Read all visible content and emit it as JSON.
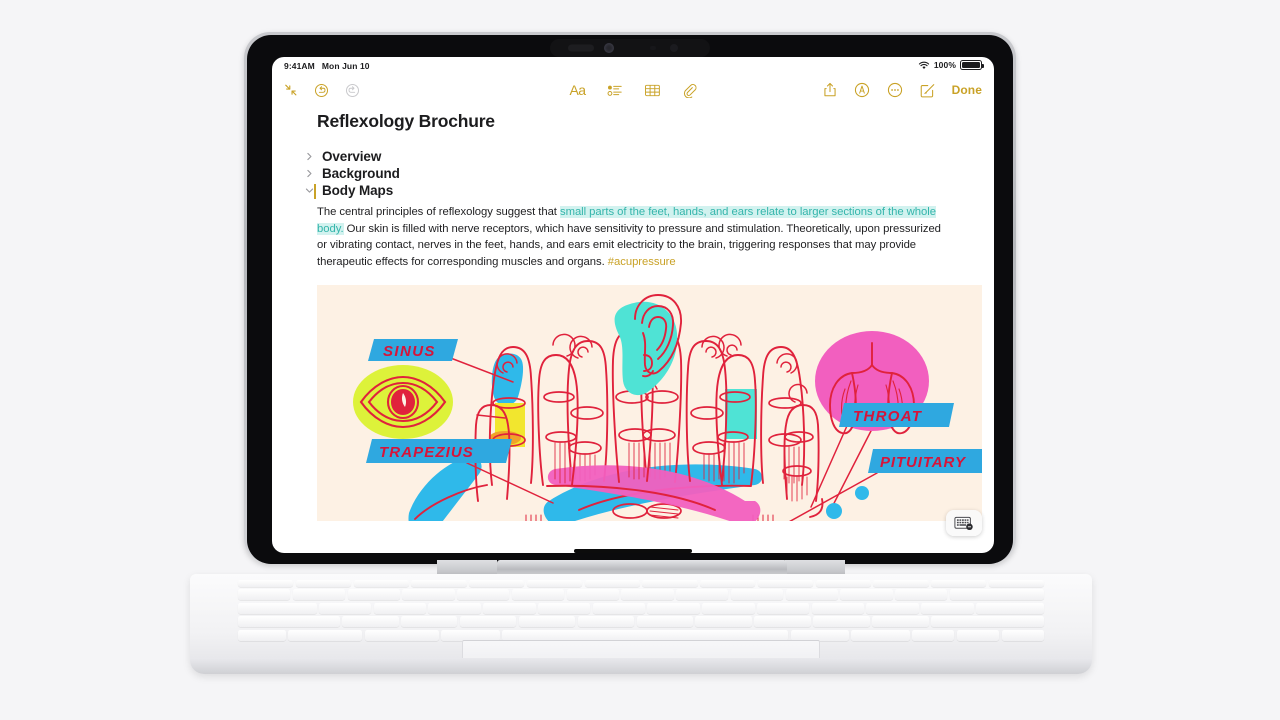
{
  "device": {
    "type": "tablet-with-keyboard",
    "label": "iPad with Magic Keyboard"
  },
  "status_bar": {
    "time": "9:41AM",
    "date": "Mon Jun 10",
    "wifi_icon": "wifi-icon",
    "battery_percent": "100%",
    "battery_icon": "battery-full-icon"
  },
  "toolbar": {
    "left": [
      {
        "name": "collapse-icon",
        "label": "Collapse"
      },
      {
        "name": "undo-icon",
        "label": "Undo"
      },
      {
        "name": "redo-icon",
        "label": "Redo"
      }
    ],
    "center": [
      {
        "name": "format-text-icon",
        "label": "Aa"
      },
      {
        "name": "checklist-icon",
        "label": "Checklist"
      },
      {
        "name": "table-icon",
        "label": "Table"
      },
      {
        "name": "attachment-icon",
        "label": "Attach"
      }
    ],
    "right": [
      {
        "name": "share-icon",
        "label": "Share"
      },
      {
        "name": "markup-icon",
        "label": "Markup"
      },
      {
        "name": "more-icon",
        "label": "More"
      },
      {
        "name": "compose-icon",
        "label": "New Note"
      }
    ],
    "done_label": "Done"
  },
  "note": {
    "title": "Reflexology Brochure",
    "sections": [
      {
        "label": "Overview",
        "expanded": false
      },
      {
        "label": "Background",
        "expanded": false
      },
      {
        "label": "Body Maps",
        "expanded": true
      }
    ],
    "paragraph": {
      "lead": "The central principles of reflexology suggest that ",
      "highlight": "small parts of the feet, hands, and ears relate to larger sections of the whole body.",
      "rest": " Our skin is filled with nerve receptors, which have sensitivity to pressure and stimulation. Theoretically, upon pressurized or vibrating contact, nerves in the feet, hands, and ears emit electricity to the brain, triggering responses that may provide therapeutic effects for corresponding muscles and organs. ",
      "hashtag": "#acupressure"
    }
  },
  "illustration": {
    "name": "reflexology-hands-diagram",
    "background_color": "#fdf1e4",
    "ink_color": "#e0223c",
    "labels": [
      {
        "text": "SINUS",
        "color": "#2fa8e0"
      },
      {
        "text": "TRAPEZIUS",
        "color": "#2fa8e0"
      },
      {
        "text": "THROAT",
        "color": "#2fa8e0"
      },
      {
        "text": "PITUITARY",
        "color": "#2fa8e0"
      }
    ],
    "organs": [
      {
        "name": "eye-illustration",
        "highlight": "#ddf23a"
      },
      {
        "name": "ear-illustration",
        "highlight": "#4fe3d5"
      },
      {
        "name": "lungs-illustration",
        "highlight": "#f museum"
      }
    ]
  },
  "floating_button": {
    "name": "keyboard-shortcut-button",
    "icon": "keyboard-icon"
  },
  "colors": {
    "accent_gold": "#c9a227",
    "highlight_text": "#34b5ab",
    "highlight_bg": "#d2f2ef",
    "page_bg": "#f5f5f7",
    "illo_bg": "#fdf1e4",
    "label_blue": "#2fa8e0",
    "ink_red": "#e0223c",
    "pink": "#f25fbf",
    "lime": "#ddf23a",
    "cyan": "#4fe3d5"
  }
}
